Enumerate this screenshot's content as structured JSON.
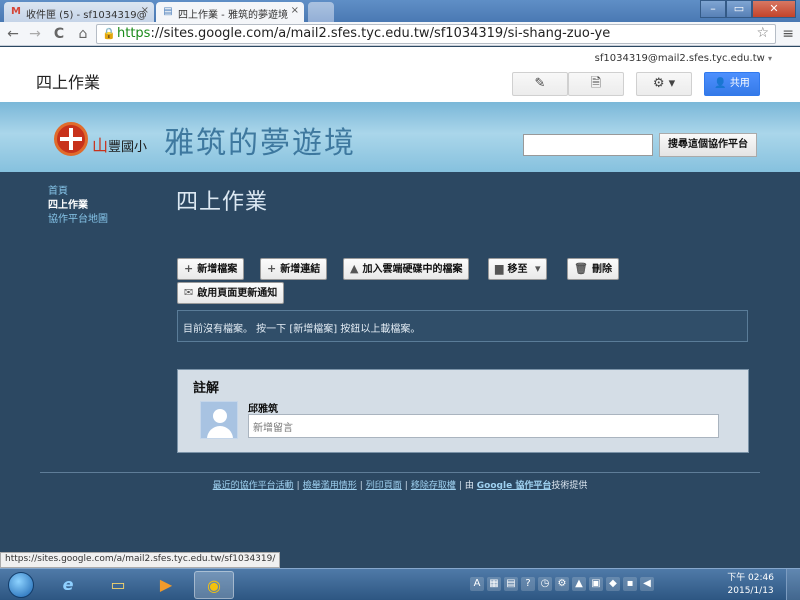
{
  "browser": {
    "tabs": [
      {
        "title": "收件匣 (5) - sf1034319@",
        "icon": "gmail-icon",
        "favicon_glyph": "M"
      },
      {
        "title": "四上作業 - 雅筑的夢遊境",
        "icon": "sites-icon",
        "favicon_glyph": "▤"
      }
    ],
    "close_glyph": "×",
    "window_buttons": {
      "minimize": "–",
      "maximize": "▭",
      "close": "✕"
    },
    "nav": {
      "back": "←",
      "forward": "→",
      "reload": "C",
      "home": "⌂"
    },
    "url_scheme": "https",
    "url_rest": "://sites.google.com/a/mail2.sfes.tyc.edu.tw/sf1034319/si-shang-zuo-ye",
    "star_glyph": "☆",
    "menu_glyph": "≡"
  },
  "sites_header": {
    "user_email": "sf1034319@mail2.sfes.tyc.edu.tw",
    "caret": "▾",
    "site_title": "四上作業",
    "edit_icon_glyph": "✎",
    "newpage_icon_glyph": "🗎",
    "settings_glyph": "⚙ ▾",
    "share_label": "共用",
    "share_icon_glyph": "👤"
  },
  "banner": {
    "logo_text_mountain": "山",
    "logo_text": "豐國小",
    "title": "雅筑的夢遊境",
    "search_placeholder": "",
    "search_button": "搜尋這個協作平台"
  },
  "sidebar": {
    "items": [
      {
        "label": "首頁",
        "current": false
      },
      {
        "label": "四上作業",
        "current": true
      },
      {
        "label": "協作平台地圖",
        "current": false
      }
    ]
  },
  "main": {
    "page_title": "四上作業",
    "buttons": {
      "new_file": "新增檔案",
      "new_link": "新增連結",
      "add_from_drive": "加入雲端硬碟中的檔案",
      "move_to": "移至",
      "delete": "刪除",
      "subscribe": "啟用頁面更新通知"
    },
    "glyphs": {
      "plus": "+",
      "drive": "▲",
      "folder": "▆",
      "caret": "▾",
      "trash": "🗑",
      "mail": "✉"
    },
    "empty_notice": "目前沒有檔案。 按一下 [新增檔案] 按鈕以上載檔案。"
  },
  "comments": {
    "heading": "註解",
    "user_name": "邱雅筑",
    "input_placeholder": "新增留言"
  },
  "footer": {
    "links": [
      "最近的協作平台活動",
      "檢舉濫用情形",
      "列印頁面",
      "移除存取權"
    ],
    "powered_prefix": "由",
    "powered_link": "Google 協作平台",
    "powered_suffix": "技術提供",
    "separator": "|"
  },
  "status_url": "https://sites.google.com/a/mail2.sfes.tyc.edu.tw/sf1034319/",
  "taskbar": {
    "icons": [
      {
        "name": "ie-icon",
        "glyph": "e"
      },
      {
        "name": "file-explorer-icon",
        "glyph": "▭"
      },
      {
        "name": "media-player-icon",
        "glyph": "▶"
      },
      {
        "name": "chrome-icon",
        "glyph": "◉"
      }
    ],
    "tray_glyphs": [
      "A",
      "▦",
      "▤",
      "?",
      "◷",
      "⚙",
      "▲",
      "▣",
      "◆",
      "▪",
      "◀"
    ],
    "time": "下午 02:46",
    "date": "2015/1/13"
  },
  "colors": {
    "page_bg": "#2c4862",
    "link": "#86c4e8",
    "share_button": "#4d90fe"
  }
}
